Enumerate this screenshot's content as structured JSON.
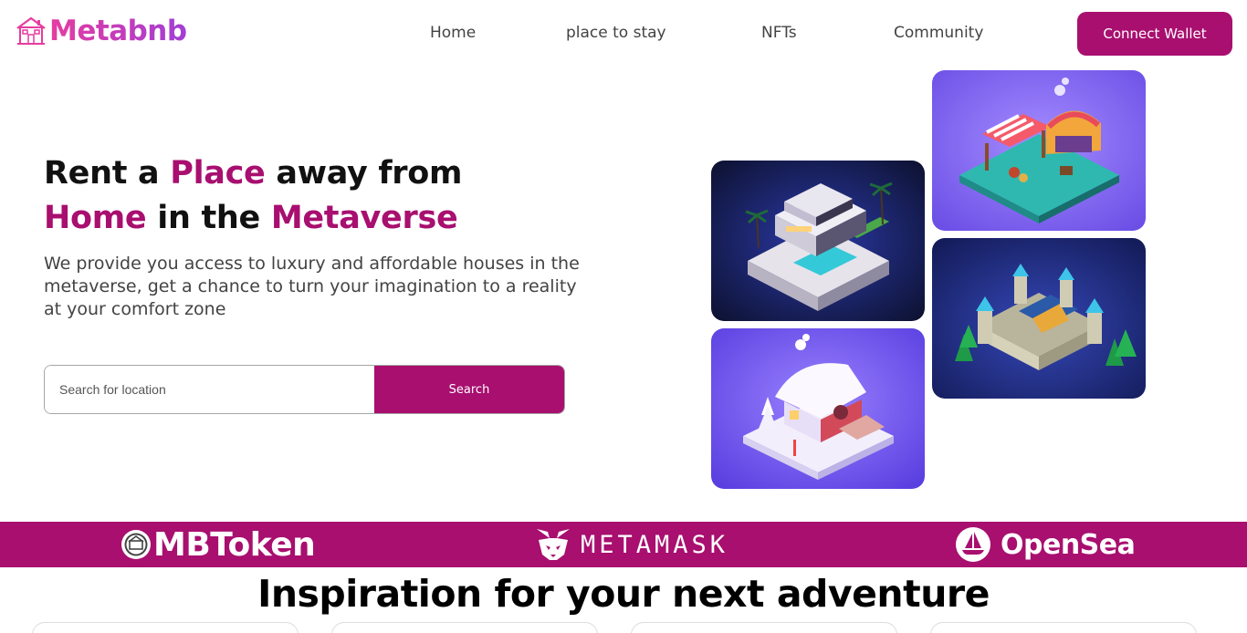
{
  "brand": {
    "name": "Metabnb",
    "icon": "house-icon"
  },
  "nav": {
    "items": [
      "Home",
      "place to stay",
      "NFTs",
      "Community"
    ],
    "connect_label": "Connect Wallet"
  },
  "hero": {
    "title_line1": [
      "Rent a ",
      "Place",
      " away from"
    ],
    "title_line2": [
      "Home",
      " in the ",
      "Metaverse"
    ],
    "description": "We provide you access to luxury and affordable houses in the metaverse, get a chance to turn your imagination to a reality at your comfort zone",
    "search_placeholder": "Search for location",
    "search_value": "",
    "search_label": "Search"
  },
  "gallery": [
    {
      "name": "villa-image",
      "icon": "modern-villa-illustration"
    },
    {
      "name": "market-image",
      "icon": "market-stall-illustration"
    },
    {
      "name": "castle-image",
      "icon": "castle-illustration"
    },
    {
      "name": "snow-house-image",
      "icon": "snow-house-illustration"
    }
  ],
  "partners": [
    {
      "name": "MBToken",
      "icon": "mbtoken-coin-icon"
    },
    {
      "name": "METAMASK",
      "icon": "fox-icon"
    },
    {
      "name": "OpenSea",
      "icon": "opensea-boat-icon"
    }
  ],
  "section": {
    "title": "Inspiration for your next adventure"
  },
  "colors": {
    "accent": "#a80f6f",
    "logo_gradient": [
      "#e63ca0",
      "#a23ed6"
    ],
    "text": "#434343"
  }
}
